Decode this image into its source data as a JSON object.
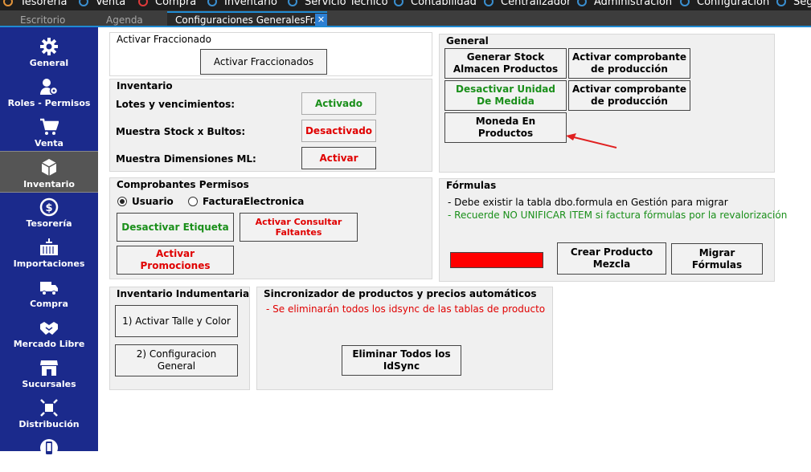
{
  "topmenu": [
    "Tesorería",
    "Venta",
    "Compra",
    "Inventario",
    "Servicio Técnico",
    "Contabilidad",
    "Centralizador",
    "Administración",
    "Configuración",
    "Seg"
  ],
  "tabs": [
    "Escritorio",
    "Agenda",
    "Configuraciones GeneralesFr..."
  ],
  "tab_close": "✕",
  "sidebar": [
    "General",
    "Roles - Permisos",
    "Venta",
    "Inventario",
    "Tesorería",
    "Importaciones",
    "Compra",
    "Mercado Libre",
    "Sucursales",
    "Distribución"
  ],
  "fraccionado": {
    "title": "Activar Fraccionado",
    "button": "Activar Fraccionados"
  },
  "inventario": {
    "title": "Inventario",
    "rows": [
      {
        "label": "Lotes y vencimientos:",
        "button": "Activado"
      },
      {
        "label": "Muestra Stock x Bultos:",
        "button": "Desactivado"
      },
      {
        "label": "Muestra Dimensiones ML:",
        "button": "Activar"
      }
    ]
  },
  "comprobantes": {
    "title": "Comprobantes Permisos",
    "radio_usuario": "Usuario",
    "radio_factura": "FacturaElectronica",
    "btn_etiqueta": "Desactivar Etiqueta",
    "btn_faltantes": "Activar Consultar Faltantes",
    "btn_promociones": "Activar  Promociones"
  },
  "general": {
    "title": "General",
    "btn_stock": "Generar Stock Almacen Productos",
    "btn_comprobante1": "Activar comprobante de producción",
    "btn_unidad": "Desactivar Unidad De Medida",
    "btn_comprobante2": "Activar comprobante de producción",
    "btn_moneda": "Moneda En Productos"
  },
  "formulas": {
    "title": "Fórmulas",
    "note1": "- Debe existir la tabla dbo.formula en Gestión para migrar",
    "note2": "- Recuerde NO UNIFICAR ITEM si factura fórmulas por la revalorización",
    "btn_crear": "Crear Producto Mezcla",
    "btn_migrar": "Migrar Fórmulas"
  },
  "indumentaria": {
    "title": "Inventario Indumentaria",
    "btn_talle": "1) Activar Talle y Color",
    "btn_config": "2) Configuracion General"
  },
  "sincronizador": {
    "title": "Sincronizador de productos y precios automáticos",
    "note": "- Se eliminarán todos los idsync de las tablas de producto",
    "btn_eliminar": "Eliminar Todos los IdSync"
  },
  "colors": {
    "sidebar": "#1b2a8c",
    "accent": "#1f8ad2",
    "green": "#1a8f1a",
    "red": "#e00000",
    "arrow": "#e02020"
  }
}
